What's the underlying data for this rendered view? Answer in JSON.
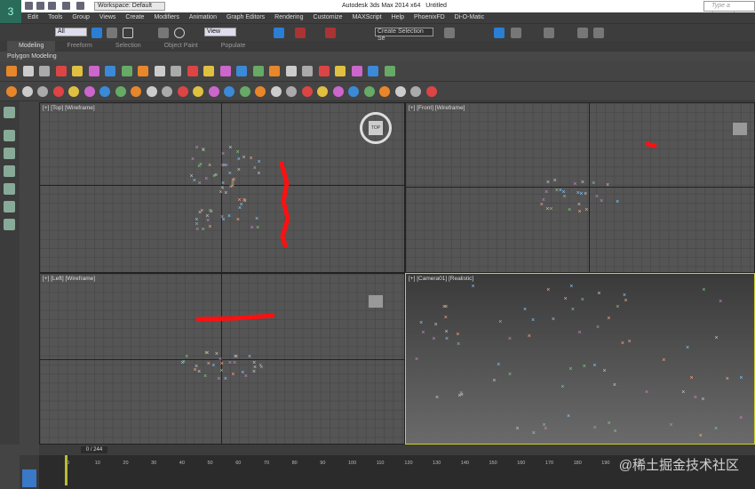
{
  "titlebar": {
    "workspace": "Workspace: Default",
    "title": "Autodesk 3ds Max  2014 x64",
    "doc": "Untitled",
    "search_placeholder": "Type a keyword or"
  },
  "menu": [
    "Edit",
    "Tools",
    "Group",
    "Views",
    "Create",
    "Modifiers",
    "Animation",
    "Graph Editors",
    "Rendering",
    "Customize",
    "MAXScript",
    "Help",
    "PhoenixFD",
    "Di-O-Matic"
  ],
  "toolbar": {
    "filter": "All",
    "ref_coord": "View",
    "selection_set": "Create Selection Se"
  },
  "ribbon": {
    "tabs": [
      "Modeling",
      "Freeform",
      "Selection",
      "Object Paint",
      "Populate"
    ],
    "active": "Modeling",
    "panel": "Polygon Modeling"
  },
  "viewports": {
    "top": "[+] [Top] [Wireframe]",
    "front": "[+] [Front] [Wireframe]",
    "left": "[+] [Left] [Wireframe]",
    "camera": "[+] [Camera01] [Realistic]"
  },
  "viewcube": "TOP",
  "timeline": {
    "frame": "0 / 244",
    "ticks": [
      "0",
      "10",
      "20",
      "30",
      "40",
      "50",
      "60",
      "70",
      "80",
      "90",
      "100",
      "110",
      "120",
      "130",
      "140",
      "150",
      "160",
      "170",
      "180",
      "190"
    ]
  },
  "watermark": "@稀土掘金技术社区",
  "colors": {
    "accent": "#2a7fd4",
    "trail": "#ff1010",
    "camera_border": "#cccc33"
  }
}
